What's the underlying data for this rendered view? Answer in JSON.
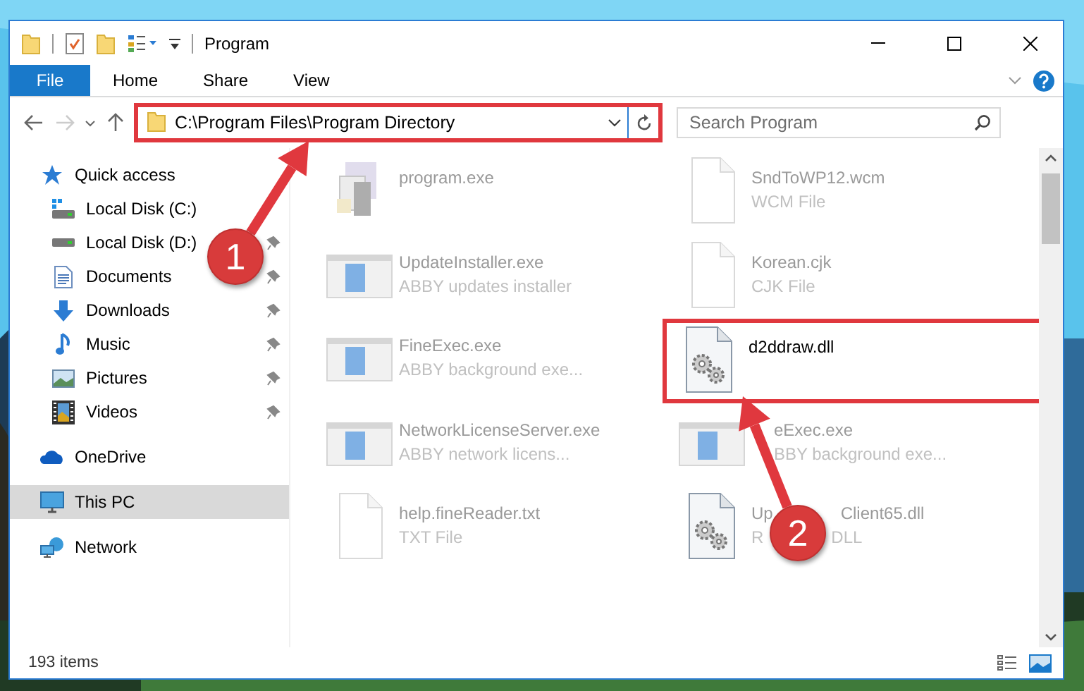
{
  "window": {
    "title": "Program"
  },
  "ribbon_tabs": [
    {
      "label": "File",
      "kind": "file_menu",
      "selected": false
    },
    {
      "label": "Home",
      "kind": "tab",
      "selected": false
    },
    {
      "label": "Share",
      "kind": "tab",
      "selected": false
    },
    {
      "label": "View",
      "kind": "tab",
      "selected": false
    }
  ],
  "address_bar": {
    "path": "C:\\Program Files\\Program Directory",
    "highlighted": true
  },
  "search": {
    "placeholder": "Search Program"
  },
  "sidebar": {
    "items": [
      {
        "label": "Quick access",
        "kind": "star",
        "selected": false,
        "children": [
          {
            "label": "Local Disk (C:)",
            "kind": "system_drive",
            "pinned": false,
            "selected": false
          },
          {
            "label": "Local Disk (D:)",
            "kind": "drive",
            "pinned": true,
            "selected": false
          },
          {
            "label": "Documents",
            "kind": "documents",
            "pinned": true,
            "selected": false
          },
          {
            "label": "Downloads",
            "kind": "downloads",
            "pinned": true,
            "selected": false
          },
          {
            "label": "Music",
            "kind": "music",
            "pinned": true,
            "selected": false
          },
          {
            "label": "Pictures",
            "kind": "pictures",
            "pinned": true,
            "selected": false
          },
          {
            "label": "Videos",
            "kind": "videos",
            "pinned": true,
            "selected": false
          }
        ]
      },
      {
        "label": "OneDrive",
        "kind": "cloud",
        "selected": false
      },
      {
        "label": "This PC",
        "kind": "pc",
        "selected": true
      },
      {
        "label": "Network",
        "kind": "network",
        "selected": false
      }
    ]
  },
  "files": [
    {
      "name": "program.exe",
      "kind": "setup",
      "dimmed": true,
      "highlighted": false
    },
    {
      "name": "SndToWP12.wcm",
      "type": "WCM File",
      "kind": "document",
      "dimmed": true,
      "highlighted": false
    },
    {
      "name": "UpdateInstaller.exe",
      "type": "ABBY updates installer",
      "kind": "app",
      "dimmed": true,
      "highlighted": false
    },
    {
      "name": "Korean.cjk",
      "type": "CJK File",
      "kind": "document",
      "dimmed": true,
      "highlighted": false
    },
    {
      "name": "FineExec.exe",
      "type": "ABBY background exe...",
      "kind": "app",
      "dimmed": true,
      "highlighted": false
    },
    {
      "name": "d2ddraw.dll",
      "kind": "dll",
      "dimmed": false,
      "highlighted": true
    },
    {
      "name": "NetworkLicenseServer.exe",
      "type": "ABBY network licens...",
      "kind": "app",
      "dimmed": true,
      "highlighted": false
    },
    {
      "name": "eExec.exe",
      "type": "BBY background exe...",
      "kind": "app",
      "dimmed": true,
      "highlighted": false,
      "partly_covered": true
    },
    {
      "name": "help.fineReader.txt",
      "type": "TXT File",
      "kind": "document",
      "dimmed": true,
      "highlighted": false
    },
    {
      "name": "Up",
      "name_tail": "Client65.dll",
      "type": "R",
      "type_tail": "DLL",
      "kind": "dll",
      "dimmed": true,
      "highlighted": false
    }
  ],
  "status_bar": {
    "item_count": "193 items"
  },
  "callouts": [
    {
      "label": "1"
    },
    {
      "label": "2"
    }
  ]
}
